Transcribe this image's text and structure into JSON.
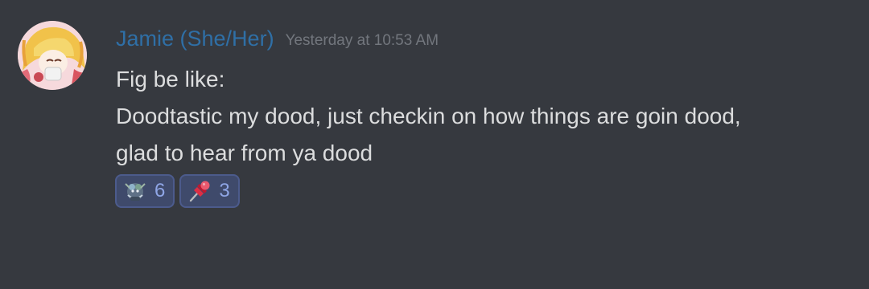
{
  "message": {
    "author": {
      "name": "Jamie (She/Her)",
      "name_color": "#2f6fa6"
    },
    "timestamp": "Yesterday at 10:53 AM",
    "lines": [
      "Fig be like:",
      "Doodtastic my dood, just checkin on how things are goin dood,",
      "glad to hear from ya dood"
    ],
    "reactions": [
      {
        "emoji": "custom-figure-emoji",
        "count": "6"
      },
      {
        "emoji": "pushpin-icon",
        "count": "3"
      }
    ]
  },
  "theme": {
    "background": "#36393f",
    "text": "#dcddde",
    "muted": "#72767d",
    "reaction_bg": "#3f4a6b",
    "reaction_border": "#4c5b8c",
    "reaction_count": "#8fa6e6"
  }
}
